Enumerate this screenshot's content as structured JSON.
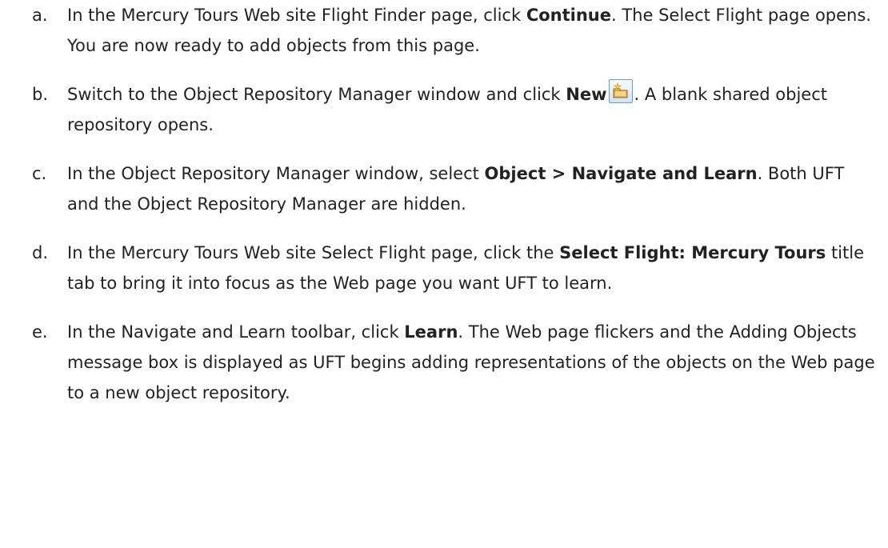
{
  "steps": [
    {
      "letter": "a.",
      "parts": [
        {
          "text": "In the Mercury Tours Web site Flight Finder page, click ",
          "bold": false
        },
        {
          "text": "Continue",
          "bold": true
        },
        {
          "text": ". The Select Flight page opens. You are now ready to add objects from this page.",
          "bold": false
        }
      ]
    },
    {
      "letter": "b.",
      "parts": [
        {
          "text": "Switch to the Object Repository Manager window and click ",
          "bold": false
        },
        {
          "text": "New",
          "bold": true
        },
        {
          "icon": "new-repository-icon"
        },
        {
          "text": ". A blank shared object repository opens.",
          "bold": false
        }
      ]
    },
    {
      "letter": "c.",
      "parts": [
        {
          "text": "In the Object Repository Manager window, select ",
          "bold": false
        },
        {
          "text": "Object > Navigate and Learn",
          "bold": true
        },
        {
          "text": ". Both UFT and the Object Repository Manager are hidden.",
          "bold": false
        }
      ]
    },
    {
      "letter": "d.",
      "parts": [
        {
          "text": "In the Mercury Tours Web site Select Flight page, click the ",
          "bold": false
        },
        {
          "text": "Select Flight: Mercury Tours",
          "bold": true
        },
        {
          "text": " title tab to bring it into focus as the Web page you want UFT to learn.",
          "bold": false
        }
      ]
    },
    {
      "letter": "e.",
      "parts": [
        {
          "text": "In the Navigate and Learn toolbar, click ",
          "bold": false
        },
        {
          "text": "Learn",
          "bold": true
        },
        {
          "text": ". The Web page flickers and the Adding Objects message box is displayed as UFT begins adding representations of the objects on the Web page to a new object repository.",
          "bold": false
        }
      ]
    }
  ]
}
